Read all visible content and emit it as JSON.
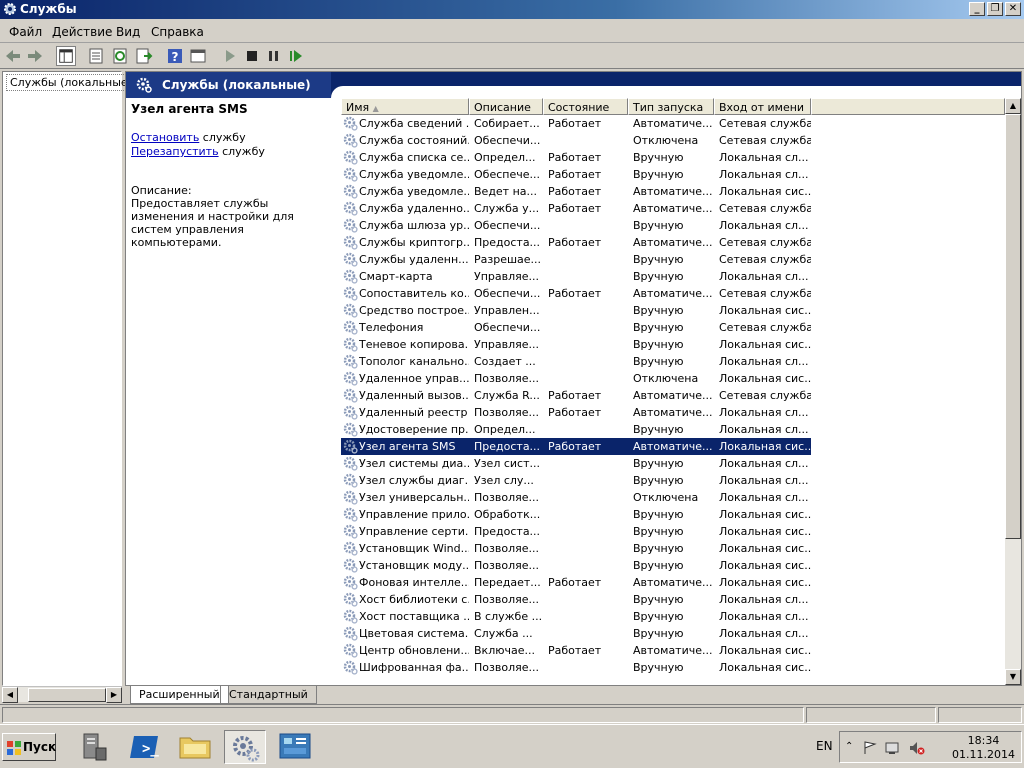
{
  "window": {
    "title": "Службы"
  },
  "menu": [
    "Файл",
    "Действие",
    "Вид",
    "Справка"
  ],
  "tree": {
    "root_label": "Службы (локальные)"
  },
  "header": {
    "title": "Службы (локальные)"
  },
  "detail": {
    "service_name": "Узел агента SMS",
    "stop_link": "Остановить",
    "stop_suffix": " службу",
    "restart_link": "Перезапустить",
    "restart_suffix": " службу",
    "description_label": "Описание:",
    "description_text": "Предоставляет службы изменения и настройки для систем управления компьютерами."
  },
  "columns": [
    "Имя",
    "Описание",
    "Состояние",
    "Тип запуска",
    "Вход от имени"
  ],
  "rows": [
    [
      "Служба сведений ...",
      "Собирает...",
      "Работает",
      "Автоматиче...",
      "Сетевая служба"
    ],
    [
      "Служба состояний...",
      "Обеспечи...",
      "",
      "Отключена",
      "Сетевая служба"
    ],
    [
      "Служба списка се...",
      "Определ...",
      "Работает",
      "Вручную",
      "Локальная сл..."
    ],
    [
      "Служба уведомле...",
      "Обеспече...",
      "Работает",
      "Вручную",
      "Локальная сл..."
    ],
    [
      "Служба уведомле...",
      "Ведет на...",
      "Работает",
      "Автоматиче...",
      "Локальная сис..."
    ],
    [
      "Служба удаленно...",
      "Служба у...",
      "Работает",
      "Автоматиче...",
      "Сетевая служба"
    ],
    [
      "Служба шлюза ур...",
      "Обеспечи...",
      "",
      "Вручную",
      "Локальная сл..."
    ],
    [
      "Службы криптогр...",
      "Предоста...",
      "Работает",
      "Автоматиче...",
      "Сетевая служба"
    ],
    [
      "Службы удаленн...",
      "Разрешае...",
      "",
      "Вручную",
      "Сетевая служба"
    ],
    [
      "Смарт-карта",
      "Управляе...",
      "",
      "Вручную",
      "Локальная сл..."
    ],
    [
      "Сопоставитель ко...",
      "Обеспечи...",
      "Работает",
      "Автоматиче...",
      "Сетевая служба"
    ],
    [
      "Средство построе...",
      "Управлен...",
      "",
      "Вручную",
      "Локальная сис..."
    ],
    [
      "Телефония",
      "Обеспечи...",
      "",
      "Вручную",
      "Сетевая служба"
    ],
    [
      "Теневое копирова...",
      "Управляе...",
      "",
      "Вручную",
      "Локальная сис..."
    ],
    [
      "Тополог канально...",
      "Создает ...",
      "",
      "Вручную",
      "Локальная сл..."
    ],
    [
      "Удаленное управ...",
      "Позволяе...",
      "",
      "Отключена",
      "Локальная сис..."
    ],
    [
      "Удаленный вызов...",
      "Служба R...",
      "Работает",
      "Автоматиче...",
      "Сетевая служба"
    ],
    [
      "Удаленный реестр",
      "Позволяе...",
      "Работает",
      "Автоматиче...",
      "Локальная сл..."
    ],
    [
      "Удостоверение пр...",
      "Определ...",
      "",
      "Вручную",
      "Локальная сл..."
    ],
    [
      "Узел агента SMS",
      "Предоста...",
      "Работает",
      "Автоматиче...",
      "Локальная сис..."
    ],
    [
      "Узел системы диа...",
      "Узел сист...",
      "",
      "Вручную",
      "Локальная сл..."
    ],
    [
      "Узел службы диаг...",
      "Узел слу...",
      "",
      "Вручную",
      "Локальная сл..."
    ],
    [
      "Узел универсальн...",
      "Позволяе...",
      "",
      "Отключена",
      "Локальная сл..."
    ],
    [
      "Управление прило...",
      "Обработк...",
      "",
      "Вручную",
      "Локальная сис..."
    ],
    [
      "Управление серти...",
      "Предоста...",
      "",
      "Вручную",
      "Локальная сис..."
    ],
    [
      "Установщик Wind...",
      "Позволяе...",
      "",
      "Вручную",
      "Локальная сис..."
    ],
    [
      "Установщик моду...",
      "Позволяе...",
      "",
      "Вручную",
      "Локальная сис..."
    ],
    [
      "Фоновая интелле...",
      "Передает...",
      "Работает",
      "Автоматиче...",
      "Локальная сис..."
    ],
    [
      "Хост библиотеки с...",
      "Позволяе...",
      "",
      "Вручную",
      "Локальная сл..."
    ],
    [
      "Хост поставщика ...",
      "В службе ...",
      "",
      "Вручную",
      "Локальная сл..."
    ],
    [
      "Цветовая система...",
      "Служба ...",
      "",
      "Вручную",
      "Локальная сл..."
    ],
    [
      "Центр обновлени...",
      "Включае...",
      "Работает",
      "Автоматиче...",
      "Локальная сис..."
    ],
    [
      "Шифрованная фа...",
      "Позволяе...",
      "",
      "Вручную",
      "Локальная сис..."
    ]
  ],
  "selected_row": 19,
  "tabs": [
    "Расширенный",
    "Стандартный"
  ],
  "taskbar": {
    "start_label": "Пуск",
    "lang": "EN",
    "time": "18:34",
    "date": "01.11.2014"
  },
  "colors": {
    "selection": "#0a246a",
    "header_bg": "#0a246a",
    "link": "#0000c0"
  }
}
